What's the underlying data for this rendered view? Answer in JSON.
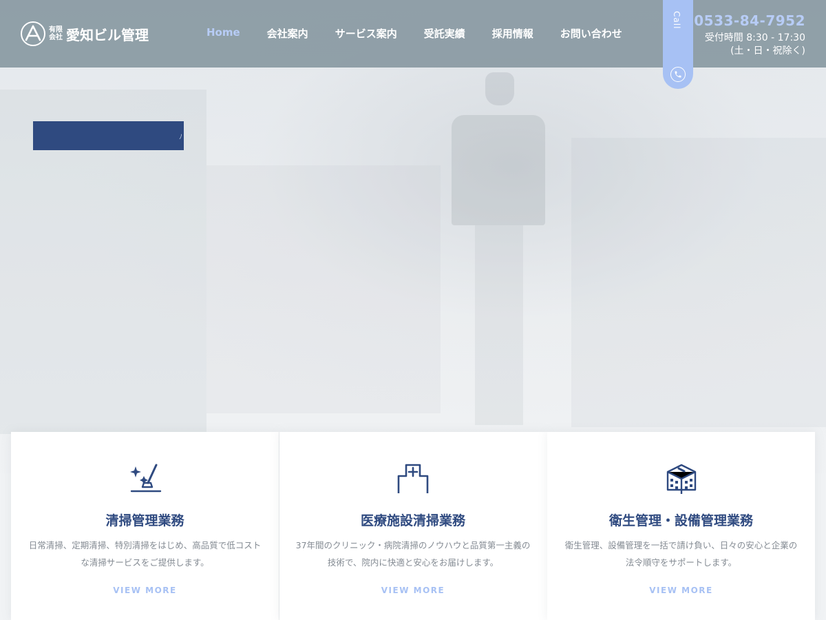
{
  "brand": {
    "small_line1": "有限",
    "small_line2": "会社",
    "name": "愛知ビル管理"
  },
  "nav": {
    "items": [
      {
        "label": "Home",
        "active": true
      },
      {
        "label": "会社案内"
      },
      {
        "label": "サービス案内"
      },
      {
        "label": "受託実績"
      },
      {
        "label": "採用情報"
      },
      {
        "label": "お問い合わせ"
      }
    ]
  },
  "call": {
    "label": "Call"
  },
  "contact": {
    "tel": "0533-84-7952",
    "hours": "受付時間 8:30 - 17:30",
    "days": "(土・日・祝除く)"
  },
  "services": [
    {
      "icon": "cleaning-icon",
      "title": "清掃管理業務",
      "description": "日常清掃、定期清掃、特別清掃をはじめ、高品質で低コストな清掃サービスをご提供します。",
      "more": "VIEW MORE"
    },
    {
      "icon": "hospital-icon",
      "title": "医療施設清掃業務",
      "description": "37年間のクリニック・病院清掃のノウハウと品質第一主義の技術で、院内に快適と安心をお届けします。",
      "more": "VIEW MORE"
    },
    {
      "icon": "building-maintenance-icon",
      "title": "衛生管理・設備管理業務",
      "description": "衛生管理、設備管理を一括で請け負い、日々の安心と企業の法令順守をサポートします。",
      "more": "VIEW MORE"
    }
  ],
  "colors": {
    "header_bg": "#8c9ca4",
    "accent": "#a7c1f4",
    "navy": "#2f4a80",
    "text_gray": "#848b93"
  }
}
